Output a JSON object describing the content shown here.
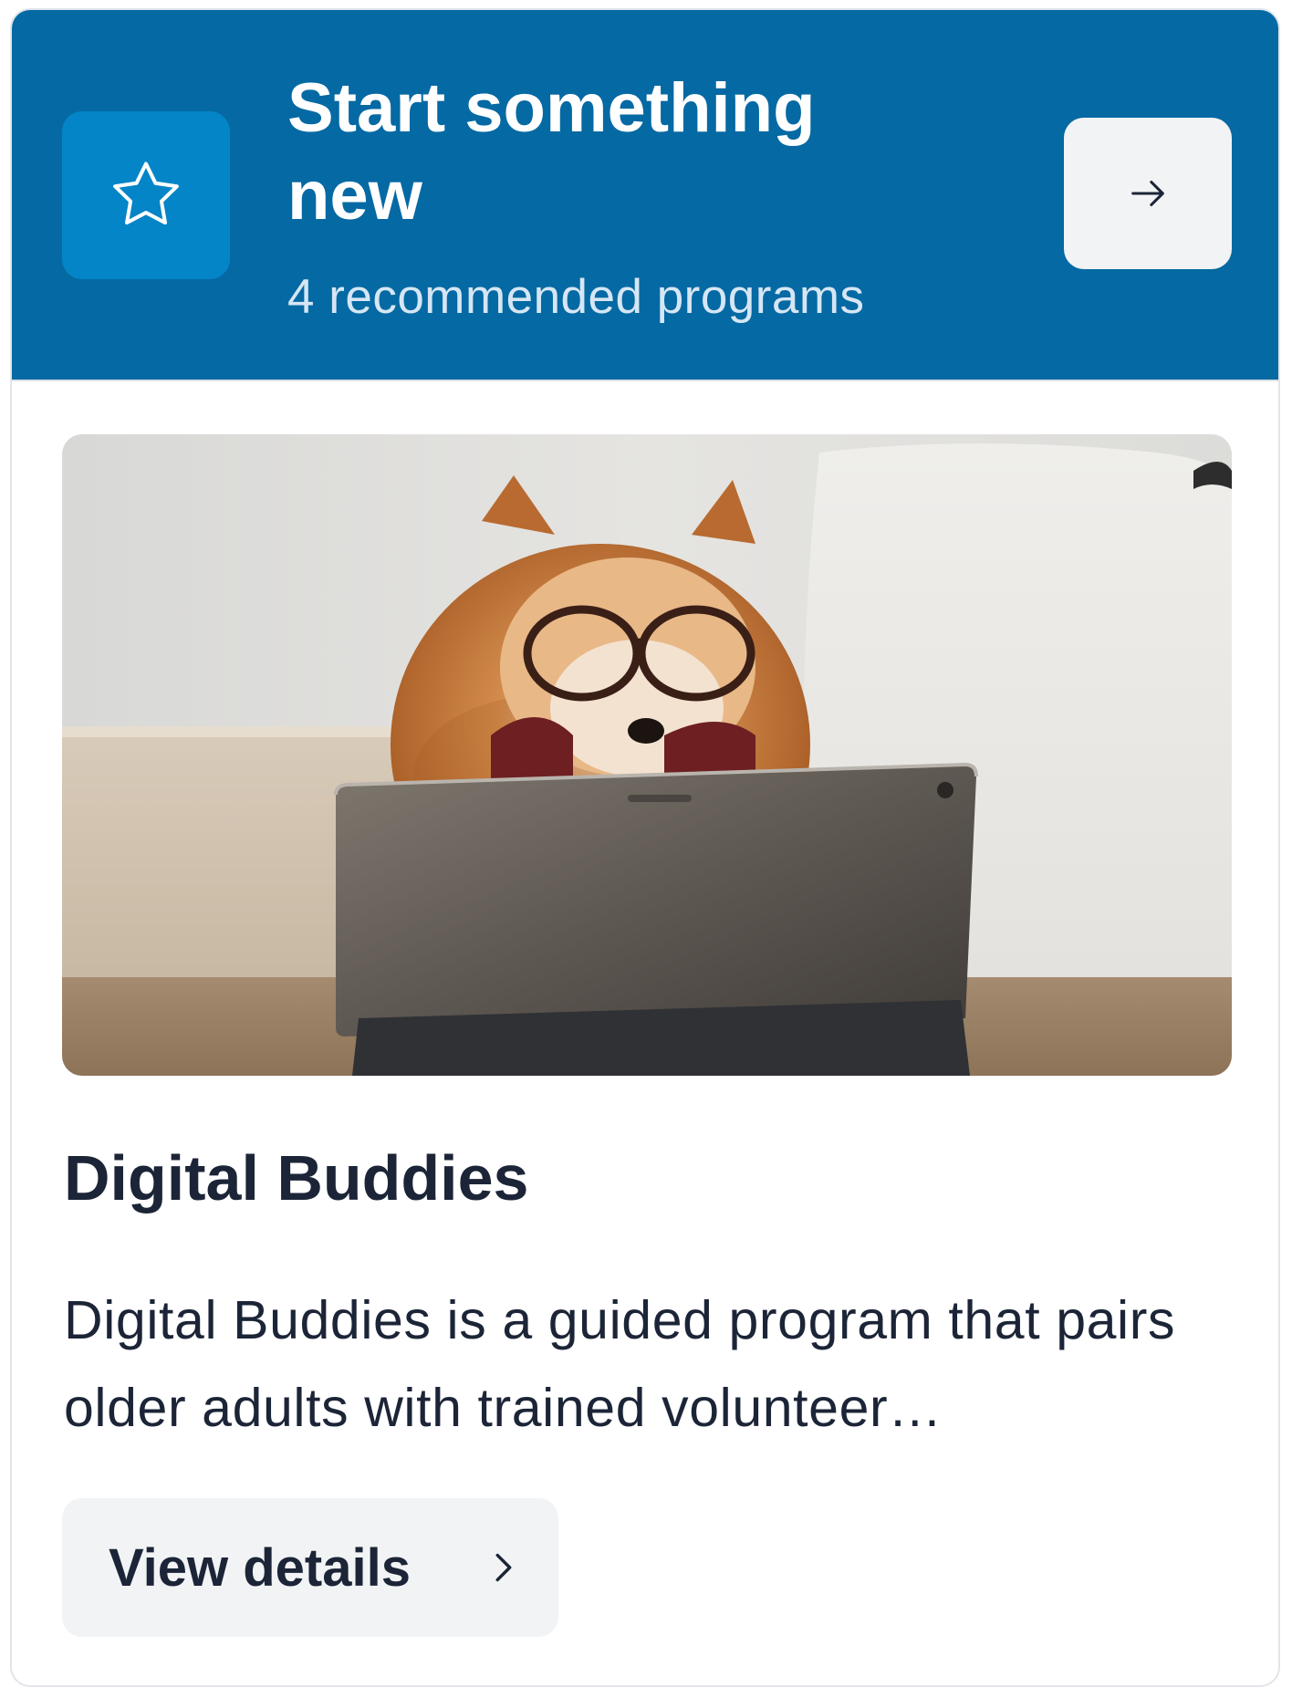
{
  "header": {
    "title": "Start something new",
    "subtitle": "4 recommended programs",
    "icon": "star-icon",
    "action_icon": "arrow-right-icon"
  },
  "program": {
    "image_subject": "pomeranian dog wearing glasses looking at a tablet",
    "title": "Digital Buddies",
    "description": "Digital Buddies is a guided program that pairs older adults with trained volunteer…",
    "button_label": "View details",
    "button_icon": "chevron-right-icon"
  },
  "colors": {
    "header_bg": "#0569a3",
    "star_tile_bg": "#0485c7",
    "button_bg": "#f2f3f5",
    "text_dark": "#1c2537"
  }
}
